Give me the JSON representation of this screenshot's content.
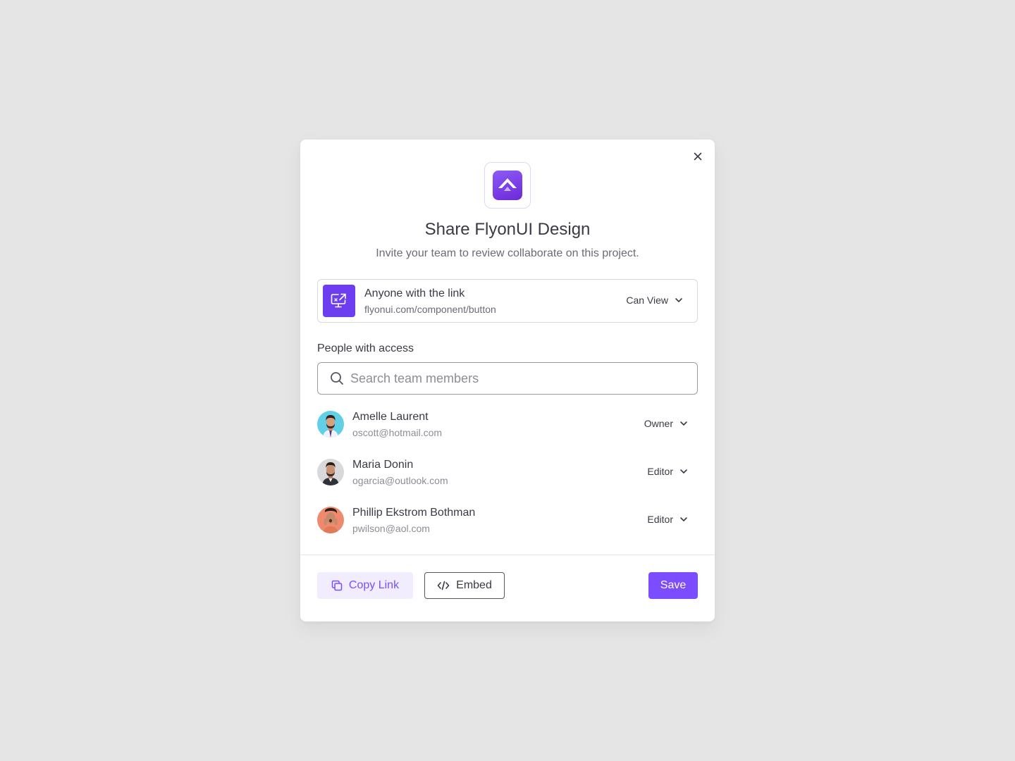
{
  "dialog": {
    "title": "Share FlyonUI Design",
    "subtitle": "Invite your team to review collaborate on this project."
  },
  "link_access": {
    "title": "Anyone with the link",
    "url": "flyonui.com/component/button",
    "permission": "Can View"
  },
  "people": {
    "label": "People with access",
    "search_placeholder": "Search team members",
    "members": [
      {
        "name": "Amelle Laurent",
        "email": "oscott@hotmail.com",
        "role": "Owner"
      },
      {
        "name": "Maria Donin",
        "email": "ogarcia@outlook.com",
        "role": "Editor"
      },
      {
        "name": "Phillip Ekstrom Bothman",
        "email": "pwilson@aol.com",
        "role": "Editor"
      }
    ]
  },
  "footer": {
    "copy_label": "Copy Link",
    "embed_label": "Embed",
    "save_label": "Save"
  },
  "colors": {
    "accent": "#7c4dff",
    "accent_soft": "#f1ecfe",
    "background": "#e5e5e5"
  }
}
